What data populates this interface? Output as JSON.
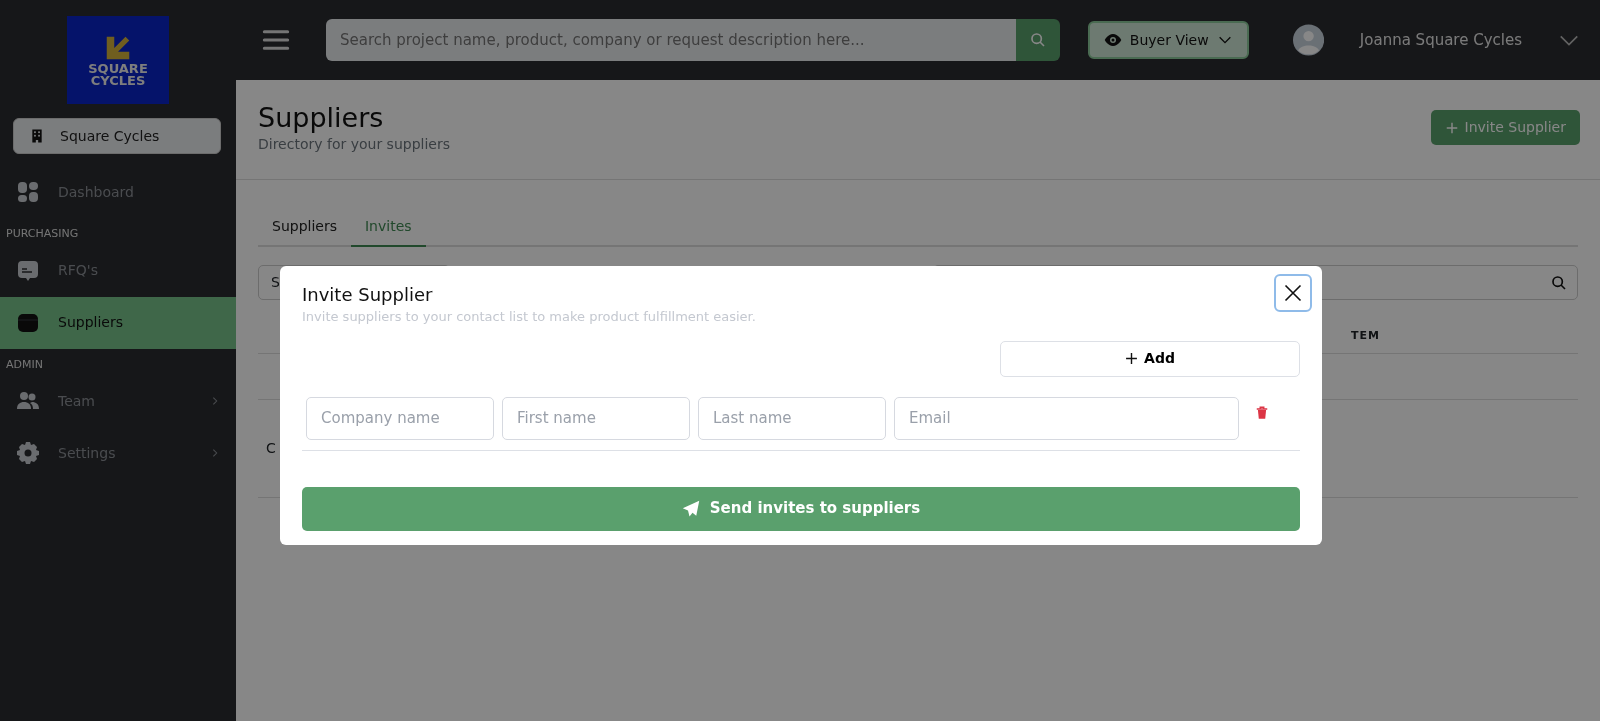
{
  "logo": {
    "line1": "SQUARE",
    "line2": "CYCLES"
  },
  "org_button": "Square Cycles",
  "sidebar": [
    {
      "kind": "item",
      "label": "Dashboard",
      "selected": false,
      "has_children": false
    },
    {
      "kind": "section",
      "label": "PURCHASING"
    },
    {
      "kind": "item",
      "label": "RFQ's",
      "selected": false,
      "has_children": false
    },
    {
      "kind": "item",
      "label": "Suppliers",
      "selected": true,
      "has_children": false
    },
    {
      "kind": "section",
      "label": "ADMIN"
    },
    {
      "kind": "item",
      "label": "Team",
      "selected": false,
      "has_children": true
    },
    {
      "kind": "item",
      "label": "Settings",
      "selected": false,
      "has_children": true
    }
  ],
  "topbar": {
    "search": {
      "placeholder": "Search project name, product, company or request description here..."
    },
    "view_button": "Buyer View",
    "user_name": "Joanna Square Cycles"
  },
  "page": {
    "title": "Suppliers",
    "subtitle": "Directory for your suppliers",
    "invite_button": "Invite Supplier",
    "tabs": [
      {
        "label": "Suppliers",
        "selected": false
      },
      {
        "label": "Invites",
        "selected": true
      }
    ],
    "filter_value": "S",
    "column_header": "TEM",
    "cell_text": "C"
  },
  "modal": {
    "title": "Invite Supplier",
    "subtitle": "Invite suppliers to your contact list to make product fulfillment easier.",
    "add_button": "Add",
    "rows": [
      {
        "fields": [
          {
            "placeholder": "Company name"
          },
          {
            "placeholder": "First name"
          },
          {
            "placeholder": "Last name"
          },
          {
            "placeholder": "Email"
          }
        ]
      }
    ],
    "submit_button": "Send invites to suppliers"
  }
}
